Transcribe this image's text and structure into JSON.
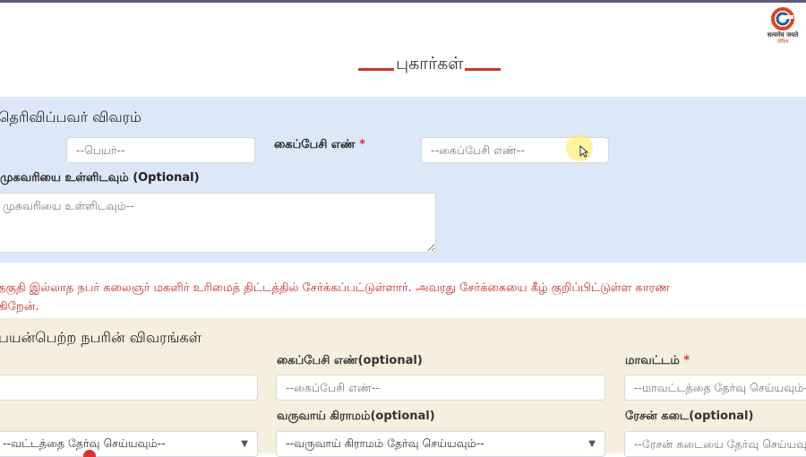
{
  "logo": {
    "line1": "सत्यमेव जयते",
    "line2": "तमिल"
  },
  "page": {
    "title": "புகார்கள்"
  },
  "informant": {
    "heading": "தெரிவிப்பவர் விவரம்",
    "name_placeholder": "--பெயர்--",
    "mobile_label": "கைப்பேசி எண்",
    "mobile_required": "*",
    "mobile_placeholder": "--கைப்பேசி எண்--",
    "address_label": "முகவரியை உள்ளிடவும் (Optional)",
    "address_placeholder": "முகவரியை உள்ளிடவும்--"
  },
  "notice": {
    "line1": "தகுதி இல்லாத நபர் கலைஞர் மகளிர் உரிமைத் திட்டத்தில் சேர்க்கப்பட்டுள்ளார். அவரது சேர்க்கையை கீழ் குறிப்பிட்டுள்ள காரண",
    "line2": "கிறேன்."
  },
  "beneficiary": {
    "heading": "பயன்பெற்ற நபரின் விவரங்கள்",
    "mobile_label": "கைப்பேசி எண்(optional)",
    "mobile_placeholder": "--கைப்பேசி எண்--",
    "district_label": "மாவட்டம்",
    "district_required": "*",
    "district_placeholder": "--மாவட்டத்தை தேர்வு செய்யவும்--",
    "left_select_value": "--வட்டத்தை தேர்வு செய்யவும்--",
    "village_label": "வருவாய் கிராமம்(optional)",
    "village_value": "--வருவாய் கிராமம் தேர்வு செய்யவும்--",
    "shop_label": "ரேசன் கடை(optional)",
    "shop_placeholder": "--ரேசன் கடையை தேர்வு செய்யவும்--"
  },
  "colors": {
    "accent_red": "#c0392b",
    "section1_bg": "#dce7f7",
    "section2_bg": "#f5efdd"
  },
  "icons": [
    "logo-icon",
    "chevron-down-icon",
    "mouse-cursor-icon"
  ]
}
